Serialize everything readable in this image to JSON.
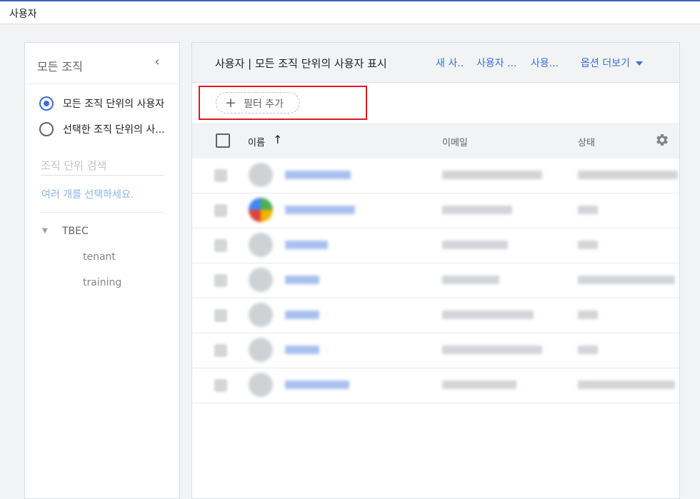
{
  "topbar": {
    "title": "사용자"
  },
  "left_panel": {
    "title": "모든 조직",
    "collapse_glyph": "‹",
    "radio_all_label": "모든 조직 단위의 사용자",
    "radio_selected_label": "선택한 조직 단위의 사...",
    "search_placeholder": "조직 단위 검색",
    "multi_select_text": "여러 개를 선택하세요.",
    "tree": {
      "root": "TBEC",
      "children": [
        "tenant",
        "training"
      ]
    }
  },
  "main_panel": {
    "title": "사용자 | 모든 조직 단위의 사용자 표시",
    "actions": [
      "새 사..",
      "사용자 ...",
      "사용...",
      "옵션 더보기"
    ],
    "filter_button_label": "필터 추가",
    "filter_plus_glyph": "+",
    "table": {
      "columns": {
        "name": "이름",
        "email": "이메일",
        "status": "상태"
      },
      "sort_glyph": "↑"
    }
  },
  "colors": {
    "accent": "#3b6fd4",
    "highlight_box": "#e0191e",
    "top_border": "#3b5fc7"
  },
  "icons": {
    "collapse": "chevron-left-icon",
    "filter_add": "plus-icon",
    "sort": "arrow-up-icon",
    "settings": "gear-icon",
    "more_options": "caret-down-icon"
  }
}
